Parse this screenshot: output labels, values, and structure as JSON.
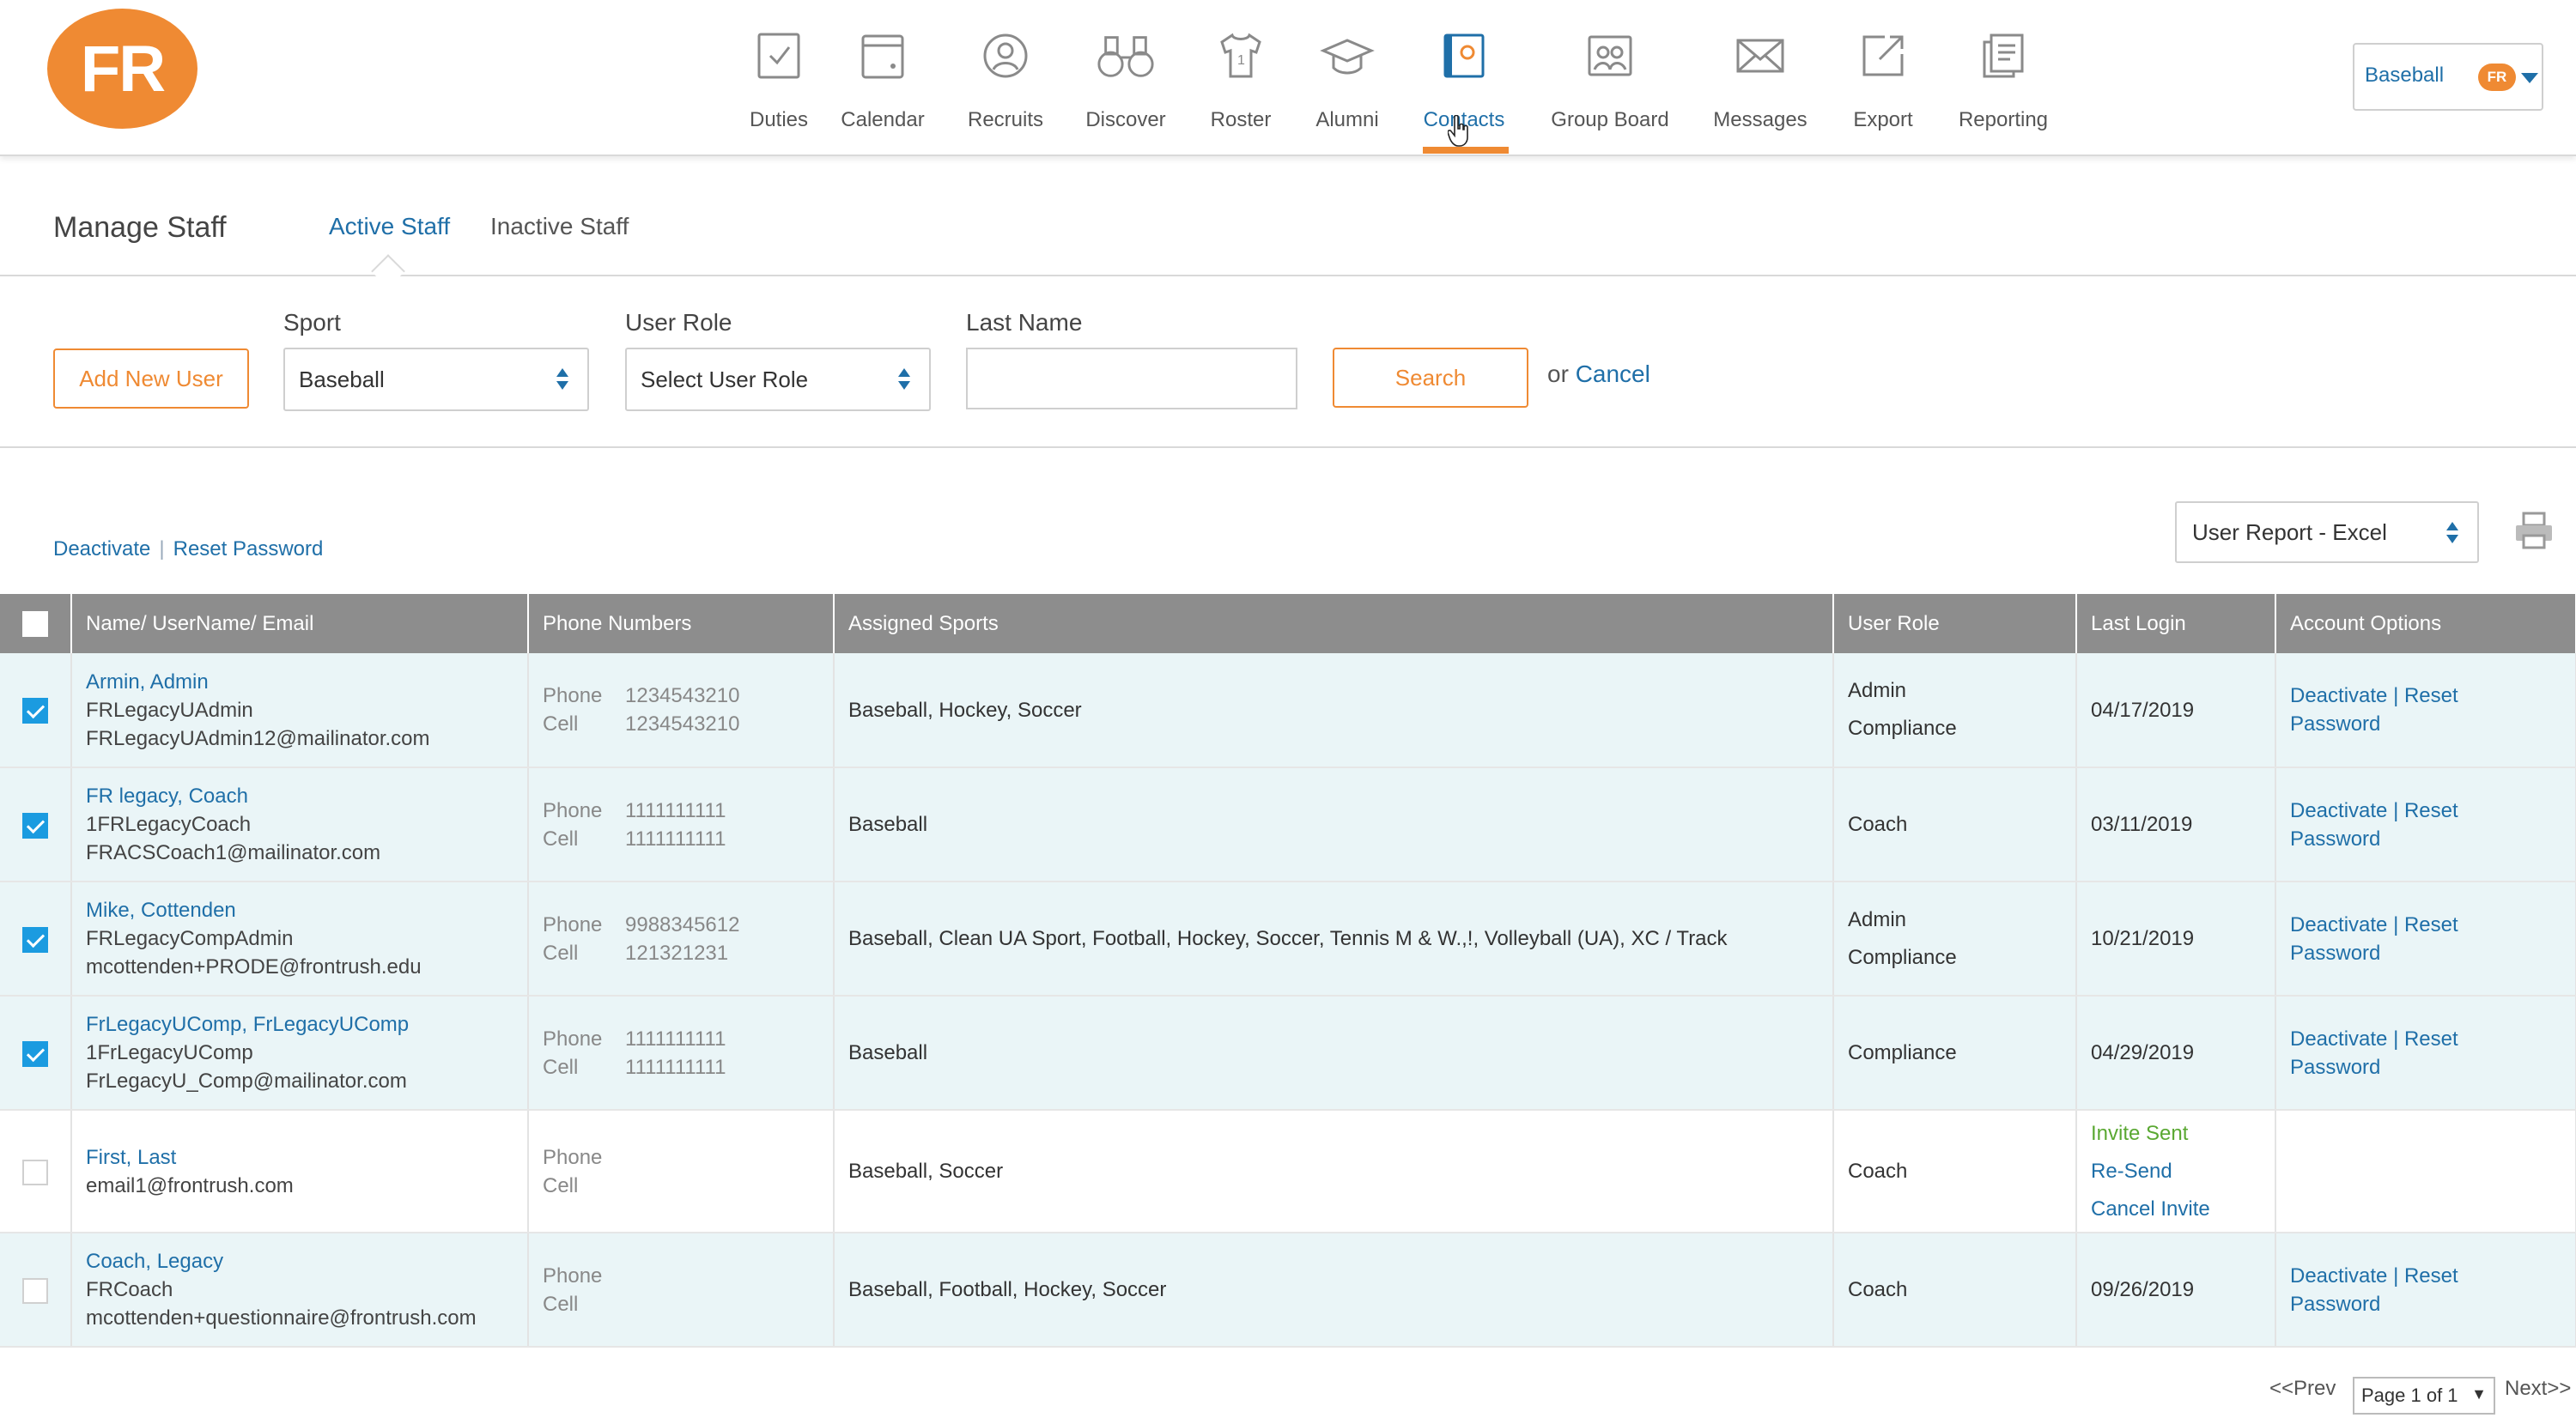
{
  "logo": {
    "text": "FR"
  },
  "nav": [
    {
      "label": "Duties",
      "icon": "duties-icon"
    },
    {
      "label": "Calendar",
      "icon": "calendar-icon"
    },
    {
      "label": "Recruits",
      "icon": "recruits-icon"
    },
    {
      "label": "Discover",
      "icon": "binoculars-icon"
    },
    {
      "label": "Roster",
      "icon": "jersey-icon"
    },
    {
      "label": "Alumni",
      "icon": "graduation-cap-icon"
    },
    {
      "label": "Contacts",
      "icon": "contacts-book-icon",
      "active": true
    },
    {
      "label": "Group Board",
      "icon": "group-board-icon"
    },
    {
      "label": "Messages",
      "icon": "envelope-icon"
    },
    {
      "label": "Export",
      "icon": "export-icon"
    },
    {
      "label": "Reporting",
      "icon": "reporting-icon"
    }
  ],
  "sport_switcher": {
    "label": "Baseball",
    "badge": "FR"
  },
  "page": {
    "title": "Manage Staff",
    "tabs": [
      "Active Staff",
      "Inactive Staff"
    ],
    "active_tab": "Active Staff"
  },
  "filters": {
    "add_user": "Add New User",
    "sport_label": "Sport",
    "sport_value": "Baseball",
    "role_label": "User Role",
    "role_value": "Select User Role",
    "lastname_label": "Last Name",
    "lastname_value": "",
    "search": "Search",
    "or": "or",
    "cancel": "Cancel"
  },
  "bulk_actions": {
    "deactivate": "Deactivate",
    "separator": "|",
    "reset": "Reset Password"
  },
  "report": {
    "value": "User Report - Excel"
  },
  "table": {
    "headers": [
      "Name/ UserName/ Email",
      "Phone Numbers",
      "Assigned Sports",
      "User Role",
      "Last Login",
      "Account Options"
    ],
    "phone_label": "Phone",
    "cell_label": "Cell",
    "rows": [
      {
        "checked": true,
        "name": "Armin, Admin",
        "username": "FRLegacyUAdmin",
        "email": "FRLegacyUAdmin12@mailinator.com",
        "phone": "1234543210",
        "cell": "1234543210",
        "sports": "Baseball, Hockey, Soccer",
        "role": [
          "Admin",
          "Compliance"
        ],
        "last_login": "04/17/2019",
        "options": [
          "Deactivate",
          "|",
          "Reset",
          "Password"
        ]
      },
      {
        "checked": true,
        "name": "FR legacy, Coach",
        "username": "1FRLegacyCoach",
        "email": "FRACSCoach1@mailinator.com",
        "phone": "1111111111",
        "cell": "1111111111",
        "sports": "Baseball",
        "role": [
          "Coach"
        ],
        "last_login": "03/11/2019",
        "options": [
          "Deactivate",
          "|",
          "Reset",
          "Password"
        ]
      },
      {
        "checked": true,
        "name": "Mike, Cottenden",
        "username": "FRLegacyCompAdmin",
        "email": "mcottenden+PRODE@frontrush.edu",
        "phone": "9988345612",
        "cell": "121321231",
        "sports": "Baseball, Clean UA Sport, Football, Hockey, Soccer, Tennis M & W.,!, Volleyball (UA), XC / Track",
        "role": [
          "Admin",
          "Compliance"
        ],
        "last_login": "10/21/2019",
        "options": [
          "Deactivate",
          "|",
          "Reset",
          "Password"
        ]
      },
      {
        "checked": true,
        "name": "FrLegacyUComp, FrLegacyUComp",
        "username": "1FrLegacyUComp",
        "email": "FrLegacyU_Comp@mailinator.com",
        "phone": "1111111111",
        "cell": "1111111111",
        "sports": "Baseball",
        "role": [
          "Compliance"
        ],
        "last_login": "04/29/2019",
        "options": [
          "Deactivate",
          "|",
          "Reset",
          "Password"
        ]
      },
      {
        "checked": false,
        "name": "First, Last",
        "username": "",
        "email": "email1@frontrush.com",
        "phone": "",
        "cell": "",
        "sports": "Baseball, Soccer",
        "role": [
          "Coach"
        ],
        "invite": [
          "Invite Sent",
          "Re-Send",
          "Cancel Invite"
        ]
      },
      {
        "checked": false,
        "name": "Coach, Legacy",
        "username": "FRCoach",
        "email": "mcottenden+questionnaire@frontrush.com",
        "phone": "",
        "cell": "",
        "sports": "Baseball, Football, Hockey, Soccer",
        "role": [
          "Coach"
        ],
        "last_login": "09/26/2019",
        "options": [
          "Deactivate",
          "|",
          "Reset",
          "Password"
        ]
      }
    ]
  },
  "pagination": {
    "prev": "<<Prev",
    "page": "Page 1 of 1",
    "next": "Next>>"
  },
  "colors": {
    "accent": "#ef8a33",
    "link": "#1f6fa8",
    "header": "#8d8d8d",
    "row_highlight": "#eaf5f7",
    "checkbox": "#1b9be0",
    "invite": "#5aa832"
  }
}
